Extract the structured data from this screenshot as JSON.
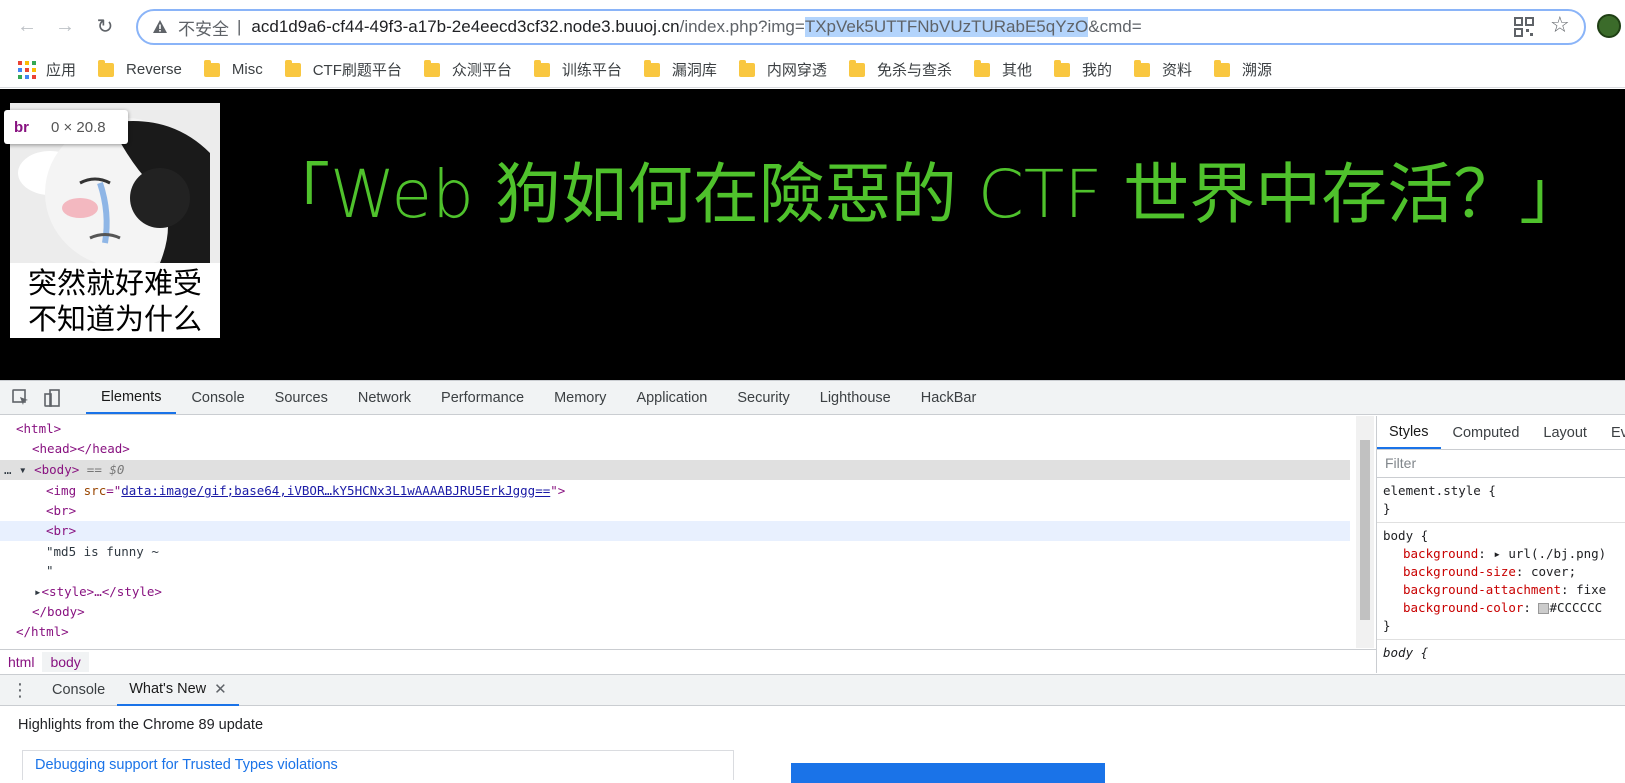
{
  "toolbar": {
    "security_label": "不安全",
    "url_host": "acd1d9a6-cf44-49f3-a17b-2e4eecd3cf32.node3.buuoj.cn",
    "url_path_before": "/index.php?img=",
    "url_selected": "TXpVek5UTTFNbVUzTURabE5qYzO",
    "url_path_after": "&cmd="
  },
  "bookmarks": {
    "apps_label": "应用",
    "folders": [
      "Reverse",
      "Misc",
      "CTF刷题平台",
      "众测平台",
      "训练平台",
      "漏洞库",
      "内网穿透",
      "免杀与查杀",
      "其他",
      "我的",
      "资料",
      "溯源"
    ]
  },
  "page": {
    "meme_caption_line1": "突然就好难受",
    "meme_caption_line2": "不知道为什么",
    "headline": "「Web 狗如何在險惡的 CTF 世界中存活？」",
    "tooltip_tag": "br",
    "tooltip_dims": "0 × 20.8"
  },
  "devtools": {
    "tabs": [
      "Elements",
      "Console",
      "Sources",
      "Network",
      "Performance",
      "Memory",
      "Application",
      "Security",
      "Lighthouse",
      "HackBar"
    ],
    "active_tab": "Elements",
    "dom": {
      "html_open": "<html>",
      "head": "<head></head>",
      "body_open": "<body>",
      "body_marker": " == $0",
      "img_tag_open": "<img ",
      "img_attr": "src",
      "img_src": "data:image/gif;base64,iVBOR…kY5HCNx3L1wAAAABJRU5ErkJggg==",
      "br": "<br>",
      "text1": "\"md5 is funny ~",
      "text2": "\"",
      "style": "<style>…</style>",
      "body_close": "</body>",
      "html_close": "</html>"
    },
    "breadcrumbs": [
      "html",
      "body"
    ],
    "styles_tabs": [
      "Styles",
      "Computed",
      "Layout",
      "Ev"
    ],
    "filter_placeholder": "Filter",
    "element_style": "element.style {",
    "body_rule": "body {",
    "props": [
      {
        "name": "background",
        "value": "url(./bj.png)"
      },
      {
        "name": "background-size",
        "value": "cover;"
      },
      {
        "name": "background-attachment",
        "value": "fixe"
      },
      {
        "name": "background-color",
        "value": "#CCCCCC"
      }
    ],
    "body_rule2": "body {"
  },
  "drawer": {
    "tabs": [
      "Console",
      "What's New"
    ],
    "active_tab": "What's New",
    "highlights": "Highlights from the Chrome 89 update",
    "card_title": "Debugging support for Trusted Types violations"
  },
  "colors": {
    "headline": "#4fc22c",
    "accent": "#1a73e8"
  }
}
